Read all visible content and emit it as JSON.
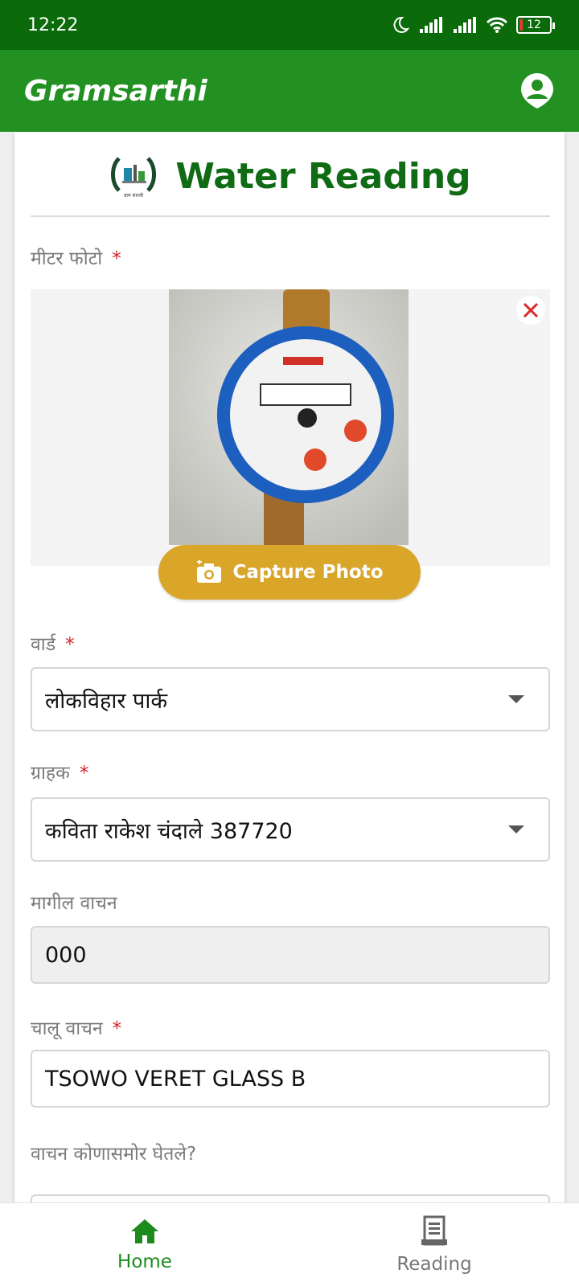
{
  "status_bar": {
    "time": "12:22",
    "battery": "12"
  },
  "app_bar": {
    "title": "Gramsarthi"
  },
  "page": {
    "title": "Water Reading",
    "logo_caption": "ग्राम सारथी"
  },
  "meter_photo": {
    "label": "मीटर फोटो",
    "required": "*",
    "capture_label": "Capture Photo"
  },
  "ward": {
    "label": "वार्ड",
    "required": "*",
    "value": "लोकविहार पार्क"
  },
  "customer": {
    "label": "ग्राहक",
    "required": "*",
    "value": "कविता  राकेश  चंदाले  387720"
  },
  "previous_reading": {
    "label": "मागील वाचन",
    "value": "000"
  },
  "current_reading": {
    "label": "चालू वाचन",
    "required": "*",
    "value": "TSOWO VERET GLASS B"
  },
  "taken_in_front_of": {
    "label": "वाचन कोणासमोर घेतले?"
  },
  "bottom_nav": {
    "home": "Home",
    "reading": "Reading"
  },
  "colors": {
    "status_bar": "#0b6b0b",
    "app_bar": "#229122",
    "title_green": "#0f6b14",
    "capture_button": "#d9a62a",
    "required": "#d0232a"
  }
}
